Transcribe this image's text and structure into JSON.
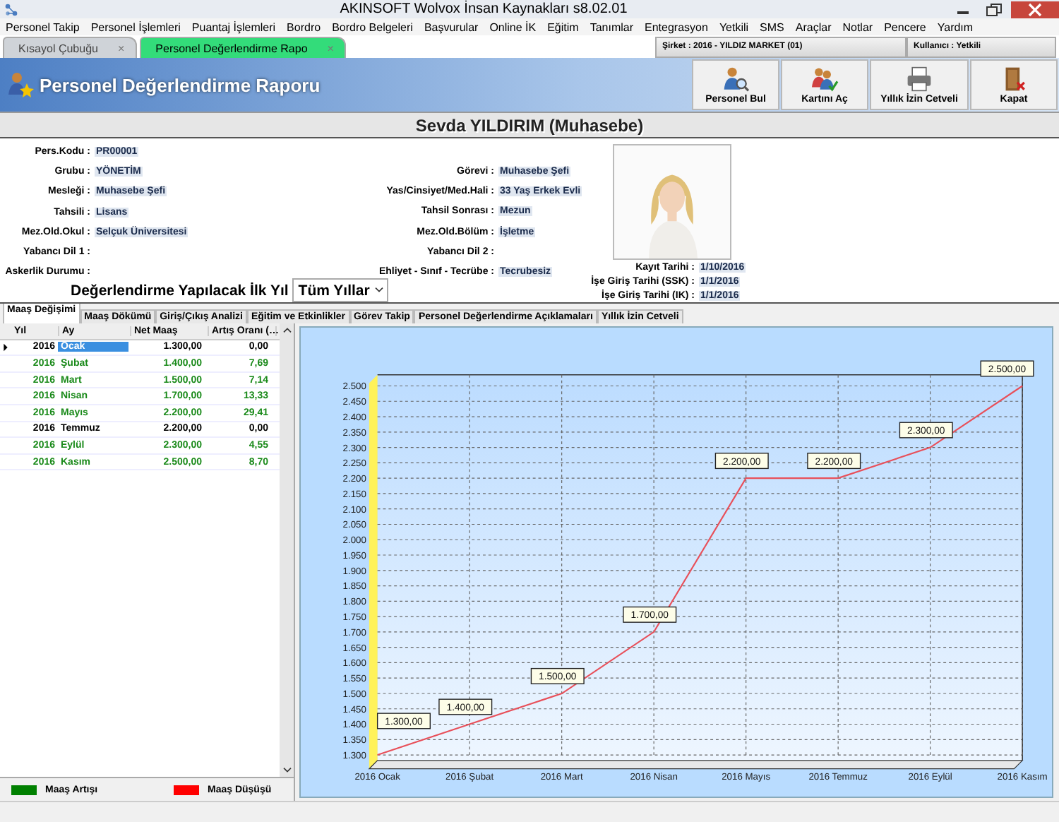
{
  "window": {
    "title": "AKINSOFT Wolvox İnsan Kaynakları s8.02.01"
  },
  "menu": [
    "Personel Takip",
    "Personel İşlemleri",
    "Puantaj İşlemleri",
    "Bordro",
    "Bordro Belgeleri",
    "Başvurular",
    "Online İK",
    "Eğitim",
    "Tanımlar",
    "Entegrasyon",
    "Yetkili",
    "SMS",
    "Araçlar",
    "Notlar",
    "Pencere",
    "Yardım"
  ],
  "doc_tabs": [
    {
      "label": "Kısayol Çubuğu",
      "selected": false,
      "close": "×"
    },
    {
      "label": "Personel Değerlendirme Rapo",
      "selected": true,
      "close": "×"
    }
  ],
  "status_fields": [
    "Şirket : 2016 - YILDIZ MARKET (01)",
    "Kullanıcı : Yetkili"
  ],
  "header": {
    "title": "Personel Değerlendirme Raporu",
    "buttons": [
      {
        "label": "Personel Bul",
        "kind": "find"
      },
      {
        "label": "Kartını Aç",
        "kind": "card"
      },
      {
        "label": "Yıllık İzin Cetveli",
        "kind": "print"
      },
      {
        "label": "Kapat",
        "kind": "exit"
      }
    ]
  },
  "person_title": "Sevda YILDIRIM (Muhasebe)",
  "info_left": [
    {
      "label": "Pers.Kodu :",
      "value": "PR00001"
    },
    {
      "label": "Grubu :",
      "value": "YÖNETİM"
    },
    {
      "label": "Mesleği :",
      "value": "Muhasebe Şefi"
    },
    {
      "label": "Tahsili :",
      "value": "Lisans"
    },
    {
      "label": "Mez.Old.Okul :",
      "value": "Selçuk Üniversitesi"
    },
    {
      "label": "Yabancı Dil 1 :"
    },
    {
      "label": "Askerlik Durumu :"
    }
  ],
  "info_middle": [
    {
      "label": "Görevi :",
      "value": "Muhasebe Şefi"
    },
    {
      "label": "Yas/Cinsiyet/Med.Hali :",
      "value": "33 Yaş Erkek Evli"
    },
    {
      "label": "Tahsil Sonrası :",
      "value": "Mezun"
    },
    {
      "label": "Mez.Old.Bölüm :",
      "value": "İşletme"
    },
    {
      "label": "Yabancı Dil 2 :"
    },
    {
      "label": "Ehliyet - Sınıf - Tecrübe :",
      "value": "Tecrubesiz"
    }
  ],
  "info_dates": [
    {
      "label": "Kayıt Tarihi :",
      "value": "1/10/2016"
    },
    {
      "label": "İşe Giriş Tarihi (SSK) :",
      "value": "1/1/2016"
    },
    {
      "label": "İşe Giriş Tarihi (IK) :",
      "value": "1/1/2016"
    }
  ],
  "first_year": {
    "label": "Değerlendirme Yapılacak İlk Yıl",
    "value": "Tüm Yıllar"
  },
  "sub_tabs": [
    {
      "label": "Maaş Değişimi",
      "selected": true
    },
    {
      "label": "Maaş Dökümü",
      "selected": false
    },
    {
      "label": "Giriş/Çıkış Analizi",
      "selected": false
    },
    {
      "label": "Eğitim ve Etkinlikler",
      "selected": false
    },
    {
      "label": "Görev Takip",
      "selected": false
    },
    {
      "label": "Personel Değerlendirme Açıklamaları",
      "selected": false
    },
    {
      "label": "Yıllık İzin Cetveli",
      "selected": false
    }
  ],
  "table": {
    "columns": [
      "Yıl",
      "Ay",
      "Net Maaş",
      "Artış Oranı (…"
    ],
    "rows": [
      {
        "cells": [
          "2016",
          "Ocak",
          "1.300,00",
          "0,00"
        ],
        "kind": "flat",
        "selected": true
      },
      {
        "cells": [
          "2016",
          "Şubat",
          "1.400,00",
          "7,69"
        ],
        "kind": "increase",
        "selected": false
      },
      {
        "cells": [
          "2016",
          "Mart",
          "1.500,00",
          "7,14"
        ],
        "kind": "increase",
        "selected": false
      },
      {
        "cells": [
          "2016",
          "Nisan",
          "1.700,00",
          "13,33"
        ],
        "kind": "increase",
        "selected": false
      },
      {
        "cells": [
          "2016",
          "Mayıs",
          "2.200,00",
          "29,41"
        ],
        "kind": "increase",
        "selected": false
      },
      {
        "cells": [
          "2016",
          "Temmuz",
          "2.200,00",
          "0,00"
        ],
        "kind": "flat",
        "selected": false
      },
      {
        "cells": [
          "2016",
          "Eylül",
          "2.300,00",
          "4,55"
        ],
        "kind": "increase",
        "selected": false
      },
      {
        "cells": [
          "2016",
          "Kasım",
          "2.500,00",
          "8,70"
        ],
        "kind": "increase",
        "selected": false
      }
    ]
  },
  "legend": [
    {
      "label": "Maaş Artışı",
      "color": "#008000"
    },
    {
      "label": "Maaş Düşüşü",
      "color": "#ff0000"
    }
  ],
  "chart_data": {
    "type": "line",
    "categories": [
      "2016 Ocak",
      "2016 Şubat",
      "2016 Mart",
      "2016 Nisan",
      "2016 Mayıs",
      "2016 Temmuz",
      "2016 Eylül",
      "2016 Kasım"
    ],
    "grid": true,
    "series": [
      {
        "color": "#e8505a",
        "values": [
          1300,
          1400,
          1500,
          1700,
          2200,
          2200,
          2300,
          2500
        ]
      }
    ],
    "value_labels": [
      "1.300,00",
      "1.400,00",
      "1.500,00",
      "1.700,00",
      "2.200,00",
      "2.200,00",
      "2.300,00",
      "2.500,00"
    ],
    "ylim": [
      1300,
      2500
    ],
    "yticks": [
      {
        "value": 1300,
        "label": "1.300"
      },
      {
        "value": 1350,
        "label": "1.350"
      },
      {
        "value": 1400,
        "label": "1.400"
      },
      {
        "value": 1450,
        "label": "1.450"
      },
      {
        "value": 1500,
        "label": "1.500"
      },
      {
        "value": 1550,
        "label": "1.550"
      },
      {
        "value": 1600,
        "label": "1.600"
      },
      {
        "value": 1650,
        "label": "1.650"
      },
      {
        "value": 1700,
        "label": "1.700"
      },
      {
        "value": 1750,
        "label": "1.750"
      },
      {
        "value": 1800,
        "label": "1.800"
      },
      {
        "value": 1850,
        "label": "1.850"
      },
      {
        "value": 1900,
        "label": "1.900"
      },
      {
        "value": 1950,
        "label": "1.950"
      },
      {
        "value": 2000,
        "label": "2.000"
      },
      {
        "value": 2050,
        "label": "2.050"
      },
      {
        "value": 2100,
        "label": "2.100"
      },
      {
        "value": 2150,
        "label": "2.150"
      },
      {
        "value": 2200,
        "label": "2.200"
      },
      {
        "value": 2250,
        "label": "2.250"
      },
      {
        "value": 2300,
        "label": "2.300"
      },
      {
        "value": 2350,
        "label": "2.350"
      },
      {
        "value": 2400,
        "label": "2.400"
      },
      {
        "value": 2450,
        "label": "2.450"
      },
      {
        "value": 2500,
        "label": "2.500"
      }
    ]
  }
}
